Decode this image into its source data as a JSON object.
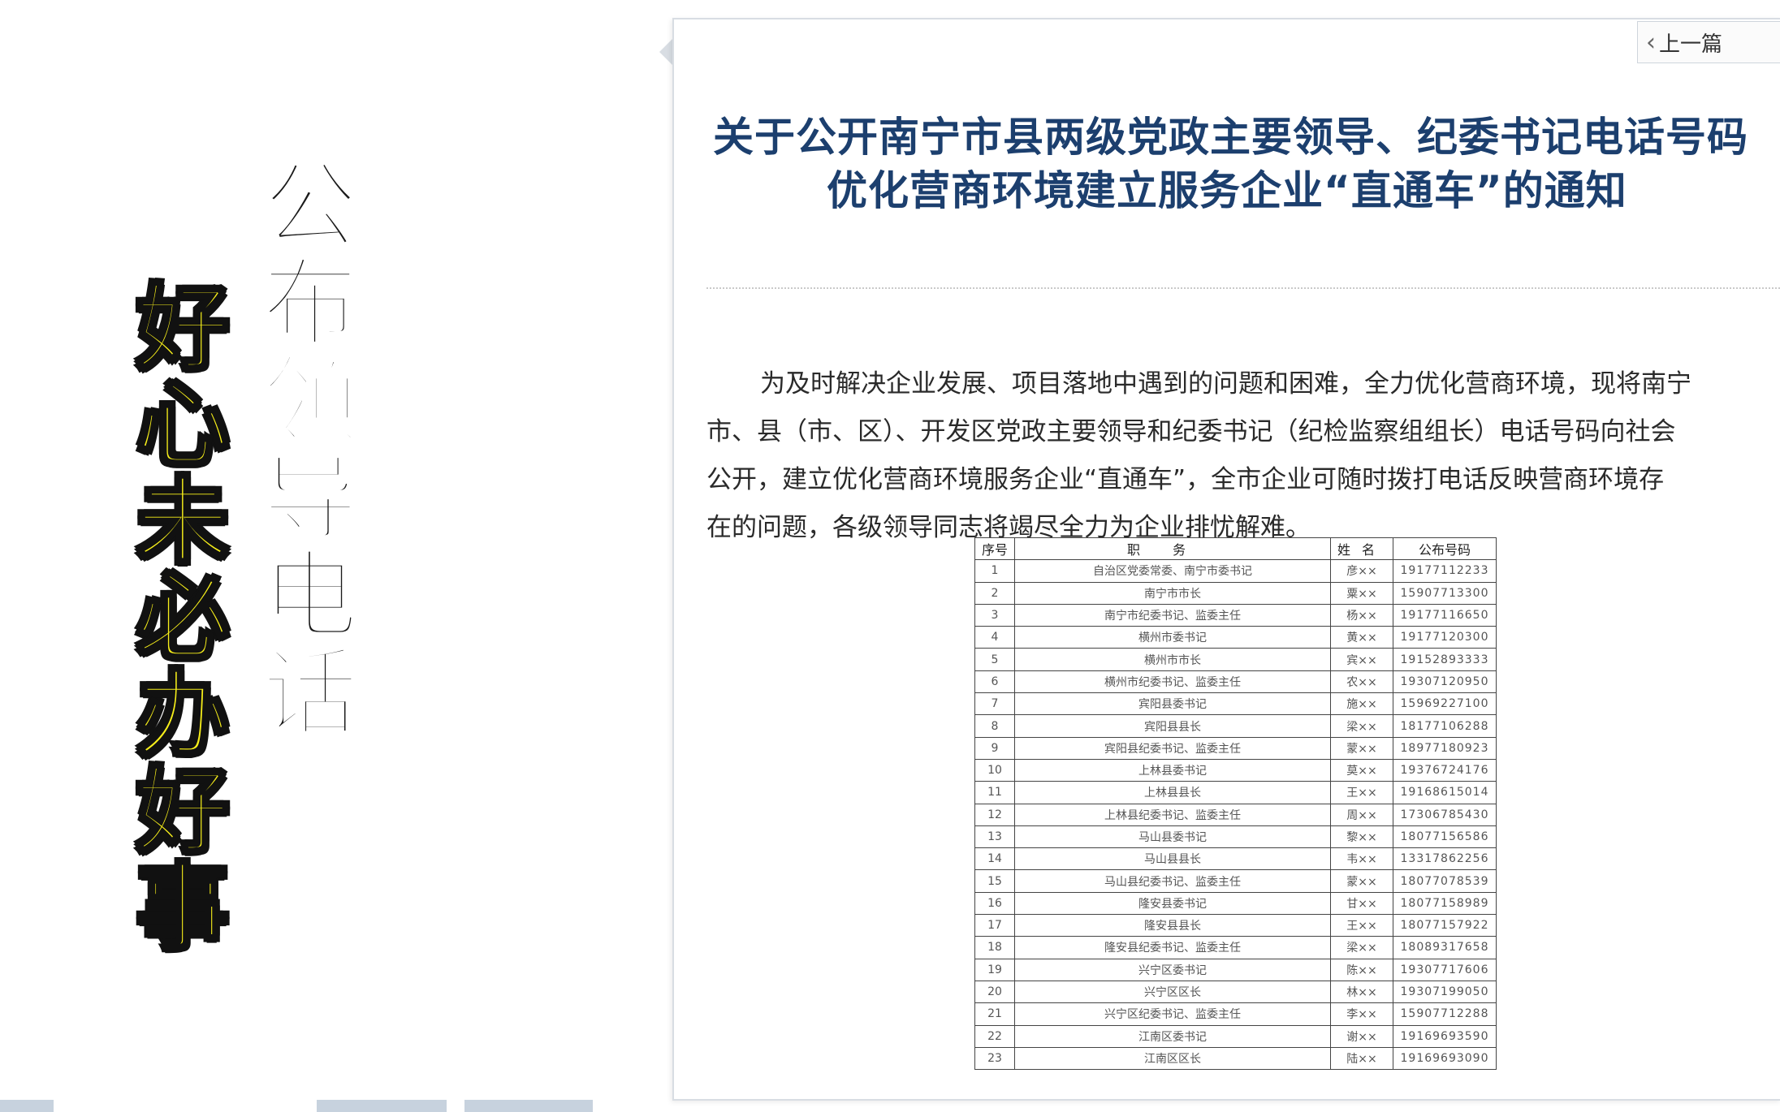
{
  "caption": {
    "black_text": [
      "公",
      "布",
      "领",
      "导",
      "电",
      "话"
    ],
    "yellow_text": [
      "好",
      "心",
      "未",
      "必",
      "办",
      "好",
      "事"
    ]
  },
  "doc": {
    "prev_label": "上一篇",
    "title_line1": "关于公开南宁市县两级党政主要领导、纪委书记电话号码",
    "title_line2": "优化营商环境建立服务企业“直通车”的通知",
    "body_lines": [
      "为及时解决企业发展、项目落地中遇到的问题和困难，全力优化营商环境，现将南宁",
      "市、县（市、区）、开发区党政主要领导和纪委书记（纪检监察组组长）电话号码向社会",
      "公开，建立优化营商环境服务企业“直通车”，全市企业可随时拨打电话反映营商环境存",
      "在的问题，各级领导同志将竭尽全力为企业排忧解难。"
    ],
    "table": {
      "headers": [
        "序号",
        "职务",
        "姓名",
        "公布号码"
      ],
      "rows": [
        [
          "1",
          "自治区党委常委、南宁市委书记",
          "彦××",
          "19177112233"
        ],
        [
          "2",
          "南宁市市长",
          "粟××",
          "15907713300"
        ],
        [
          "3",
          "南宁市纪委书记、监委主任",
          "杨××",
          "19177116650"
        ],
        [
          "4",
          "横州市委书记",
          "黄××",
          "19177120300"
        ],
        [
          "5",
          "横州市市长",
          "宾××",
          "19152893333"
        ],
        [
          "6",
          "横州市纪委书记、监委主任",
          "农××",
          "19307120950"
        ],
        [
          "7",
          "宾阳县委书记",
          "施××",
          "15969227100"
        ],
        [
          "8",
          "宾阳县县长",
          "梁××",
          "18177106288"
        ],
        [
          "9",
          "宾阳县纪委书记、监委主任",
          "蒙××",
          "18977180923"
        ],
        [
          "10",
          "上林县委书记",
          "莫××",
          "19376724176"
        ],
        [
          "11",
          "上林县县长",
          "王××",
          "19168615014"
        ],
        [
          "12",
          "上林县纪委书记、监委主任",
          "周××",
          "17306785430"
        ],
        [
          "13",
          "马山县委书记",
          "黎××",
          "18077156586"
        ],
        [
          "14",
          "马山县县长",
          "韦××",
          "13317862256"
        ],
        [
          "15",
          "马山县纪委书记、监委主任",
          "蒙××",
          "18077078539"
        ],
        [
          "16",
          "隆安县委书记",
          "甘××",
          "18077158989"
        ],
        [
          "17",
          "隆安县县长",
          "王××",
          "18077157922"
        ],
        [
          "18",
          "隆安县纪委书记、监委主任",
          "梁××",
          "18089317658"
        ],
        [
          "19",
          "兴宁区委书记",
          "陈××",
          "19307717606"
        ],
        [
          "20",
          "兴宁区区长",
          "林××",
          "19307199050"
        ],
        [
          "21",
          "兴宁区纪委书记、监委主任",
          "李××",
          "15907712288"
        ],
        [
          "22",
          "江南区委书记",
          "谢××",
          "19169693590"
        ],
        [
          "23",
          "江南区区长",
          "陆××",
          "19169693090"
        ]
      ]
    }
  },
  "colors": {
    "title": "#1c3f6e",
    "yellow_caption": "#f7ef1a",
    "black_caption": "#1a1a1a"
  }
}
